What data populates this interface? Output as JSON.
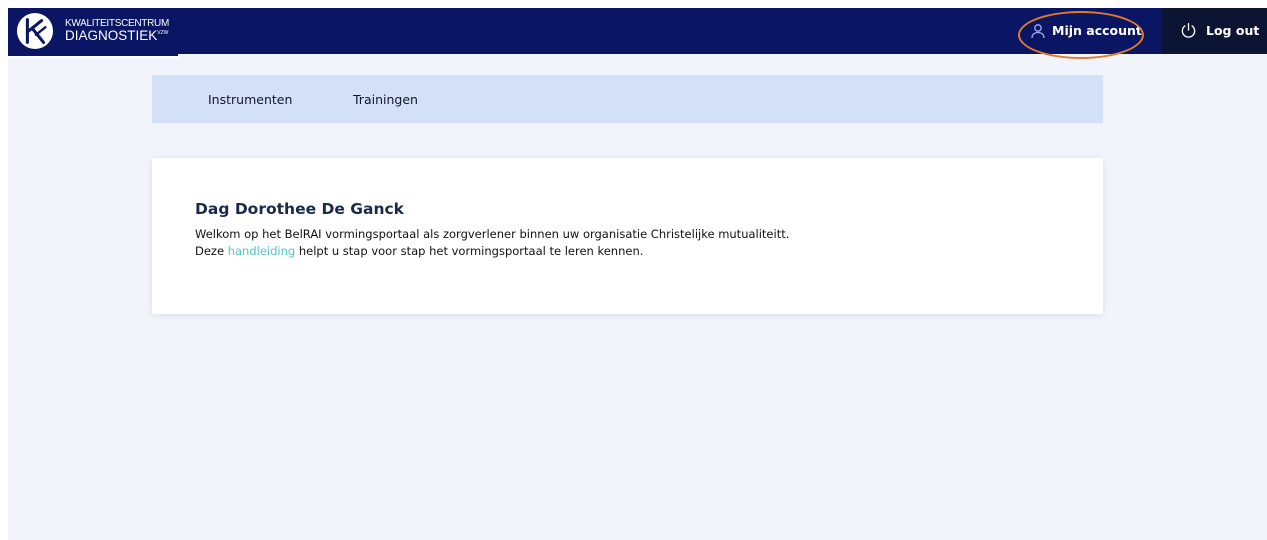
{
  "header": {
    "logo": {
      "line1": "KWALITEITSCENTRUM",
      "line2": "DIAGNOSTIEK",
      "suffix": "VZW"
    },
    "account_label": "Mijn account",
    "logout_label": "Log out"
  },
  "nav": {
    "items": [
      {
        "label": "Instrumenten"
      },
      {
        "label": "Trainingen"
      }
    ]
  },
  "welcome": {
    "title": "Dag Dorothee De Ganck",
    "line1": "Welkom op het BelRAI vormingsportaal als zorgverlener binnen uw organisatie Christelijke mutualiteitt.",
    "line2_prefix": "Deze ",
    "line2_link": "handleiding",
    "line2_suffix": " helpt u stap voor stap het vormingsportaal te leren kennen."
  },
  "icons": {
    "logo": "kcd-logo-icon",
    "account": "user-icon",
    "logout": "power-icon"
  },
  "colors": {
    "header_bg": "#0a1563",
    "logout_bg": "#0b1433",
    "page_bg": "#f1f4fb",
    "subnav_bg": "#d4e0f7",
    "link": "#4cc8c6",
    "highlight": "#e07a2e"
  }
}
